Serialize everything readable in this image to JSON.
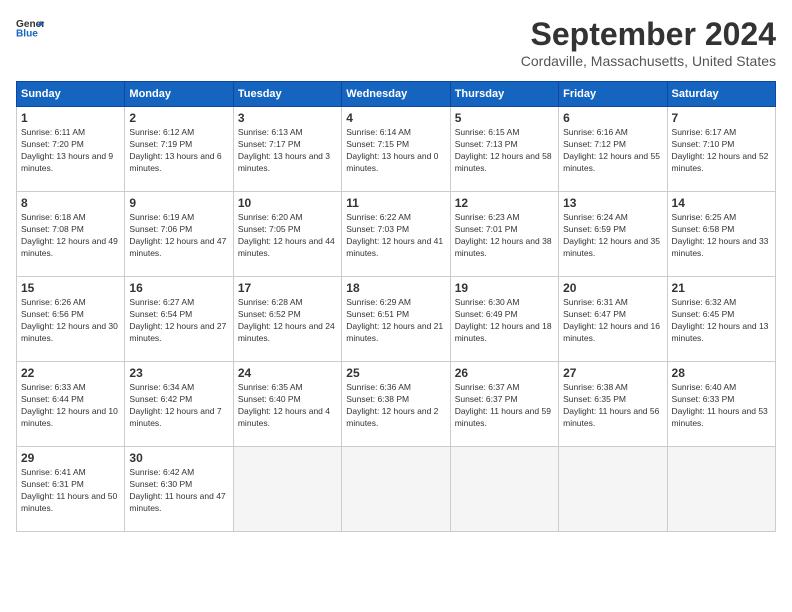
{
  "logo": {
    "general": "General",
    "blue": "Blue"
  },
  "title": "September 2024",
  "location": "Cordaville, Massachusetts, United States",
  "weekdays": [
    "Sunday",
    "Monday",
    "Tuesday",
    "Wednesday",
    "Thursday",
    "Friday",
    "Saturday"
  ],
  "weeks": [
    [
      {
        "day": "1",
        "sunrise": "6:11 AM",
        "sunset": "7:20 PM",
        "daylight": "13 hours and 9 minutes."
      },
      {
        "day": "2",
        "sunrise": "6:12 AM",
        "sunset": "7:19 PM",
        "daylight": "13 hours and 6 minutes."
      },
      {
        "day": "3",
        "sunrise": "6:13 AM",
        "sunset": "7:17 PM",
        "daylight": "13 hours and 3 minutes."
      },
      {
        "day": "4",
        "sunrise": "6:14 AM",
        "sunset": "7:15 PM",
        "daylight": "13 hours and 0 minutes."
      },
      {
        "day": "5",
        "sunrise": "6:15 AM",
        "sunset": "7:13 PM",
        "daylight": "12 hours and 58 minutes."
      },
      {
        "day": "6",
        "sunrise": "6:16 AM",
        "sunset": "7:12 PM",
        "daylight": "12 hours and 55 minutes."
      },
      {
        "day": "7",
        "sunrise": "6:17 AM",
        "sunset": "7:10 PM",
        "daylight": "12 hours and 52 minutes."
      }
    ],
    [
      {
        "day": "8",
        "sunrise": "6:18 AM",
        "sunset": "7:08 PM",
        "daylight": "12 hours and 49 minutes."
      },
      {
        "day": "9",
        "sunrise": "6:19 AM",
        "sunset": "7:06 PM",
        "daylight": "12 hours and 47 minutes."
      },
      {
        "day": "10",
        "sunrise": "6:20 AM",
        "sunset": "7:05 PM",
        "daylight": "12 hours and 44 minutes."
      },
      {
        "day": "11",
        "sunrise": "6:22 AM",
        "sunset": "7:03 PM",
        "daylight": "12 hours and 41 minutes."
      },
      {
        "day": "12",
        "sunrise": "6:23 AM",
        "sunset": "7:01 PM",
        "daylight": "12 hours and 38 minutes."
      },
      {
        "day": "13",
        "sunrise": "6:24 AM",
        "sunset": "6:59 PM",
        "daylight": "12 hours and 35 minutes."
      },
      {
        "day": "14",
        "sunrise": "6:25 AM",
        "sunset": "6:58 PM",
        "daylight": "12 hours and 33 minutes."
      }
    ],
    [
      {
        "day": "15",
        "sunrise": "6:26 AM",
        "sunset": "6:56 PM",
        "daylight": "12 hours and 30 minutes."
      },
      {
        "day": "16",
        "sunrise": "6:27 AM",
        "sunset": "6:54 PM",
        "daylight": "12 hours and 27 minutes."
      },
      {
        "day": "17",
        "sunrise": "6:28 AM",
        "sunset": "6:52 PM",
        "daylight": "12 hours and 24 minutes."
      },
      {
        "day": "18",
        "sunrise": "6:29 AM",
        "sunset": "6:51 PM",
        "daylight": "12 hours and 21 minutes."
      },
      {
        "day": "19",
        "sunrise": "6:30 AM",
        "sunset": "6:49 PM",
        "daylight": "12 hours and 18 minutes."
      },
      {
        "day": "20",
        "sunrise": "6:31 AM",
        "sunset": "6:47 PM",
        "daylight": "12 hours and 16 minutes."
      },
      {
        "day": "21",
        "sunrise": "6:32 AM",
        "sunset": "6:45 PM",
        "daylight": "12 hours and 13 minutes."
      }
    ],
    [
      {
        "day": "22",
        "sunrise": "6:33 AM",
        "sunset": "6:44 PM",
        "daylight": "12 hours and 10 minutes."
      },
      {
        "day": "23",
        "sunrise": "6:34 AM",
        "sunset": "6:42 PM",
        "daylight": "12 hours and 7 minutes."
      },
      {
        "day": "24",
        "sunrise": "6:35 AM",
        "sunset": "6:40 PM",
        "daylight": "12 hours and 4 minutes."
      },
      {
        "day": "25",
        "sunrise": "6:36 AM",
        "sunset": "6:38 PM",
        "daylight": "12 hours and 2 minutes."
      },
      {
        "day": "26",
        "sunrise": "6:37 AM",
        "sunset": "6:37 PM",
        "daylight": "11 hours and 59 minutes."
      },
      {
        "day": "27",
        "sunrise": "6:38 AM",
        "sunset": "6:35 PM",
        "daylight": "11 hours and 56 minutes."
      },
      {
        "day": "28",
        "sunrise": "6:40 AM",
        "sunset": "6:33 PM",
        "daylight": "11 hours and 53 minutes."
      }
    ],
    [
      {
        "day": "29",
        "sunrise": "6:41 AM",
        "sunset": "6:31 PM",
        "daylight": "11 hours and 50 minutes."
      },
      {
        "day": "30",
        "sunrise": "6:42 AM",
        "sunset": "6:30 PM",
        "daylight": "11 hours and 47 minutes."
      },
      null,
      null,
      null,
      null,
      null
    ]
  ]
}
